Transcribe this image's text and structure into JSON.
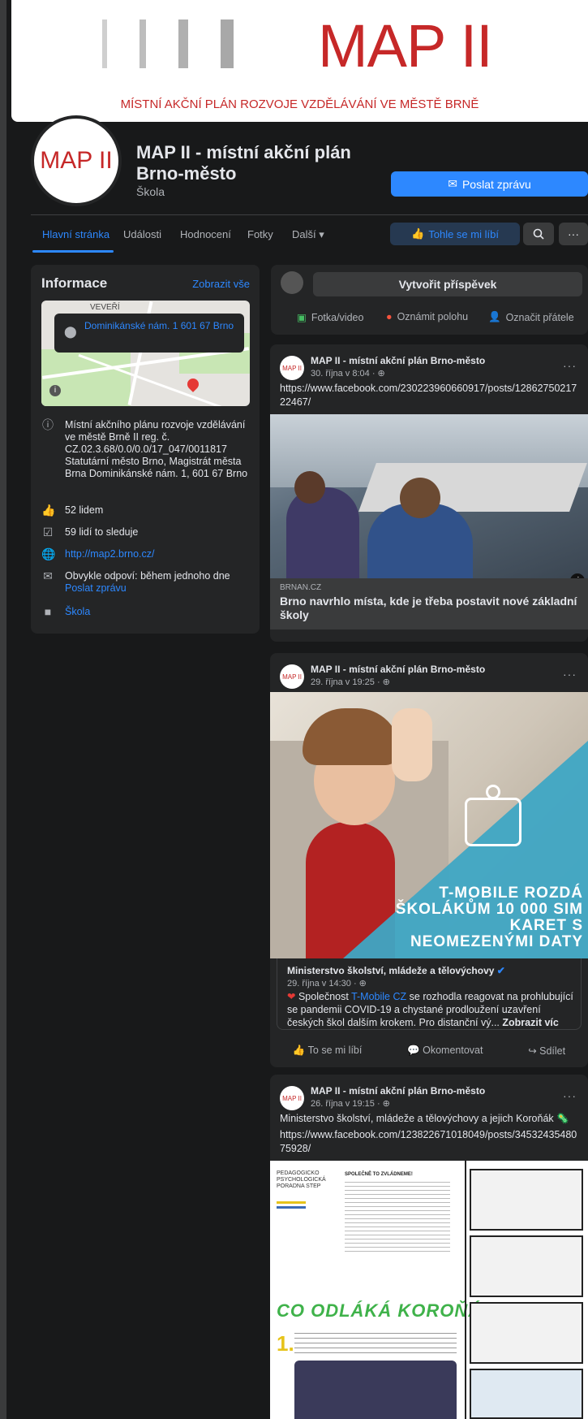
{
  "cover": {
    "title": "MAP II",
    "subtitle": "MÍSTNÍ AKČNÍ PLÁN ROZVOJE VZDĚLÁVÁNÍ VE MĚSTĚ BRNĚ"
  },
  "page": {
    "avatar_text": "MAP II",
    "name": "MAP II - místní akční plán Brno-město",
    "category": "Škola",
    "message_button": "Poslat zprávu"
  },
  "nav": {
    "tabs": [
      "Hlavní stránka",
      "Události",
      "Hodnocení",
      "Fotky",
      "Další ▾"
    ],
    "like_button": "Tohle se mi líbí",
    "search_icon": "search-icon",
    "more_icon": "more-icon"
  },
  "info": {
    "title": "Informace",
    "see_all": "Zobrazit vše",
    "map_label": "VEVEŘÍ",
    "map_address": "Dominikánské nám. 1 601 67 Brno",
    "description": "Místní akčního plánu rozvoje vzdělávání ve městě Brně II reg. č. CZ.02.3.68/0.0/0.0/17_047/0011817 Statutární město Brno, Magistrát města Brna Dominikánské nám. 1, 601 67 Brno",
    "likes": "52 lidem",
    "followers": "59 lidí to sleduje",
    "website": "http://map2.brno.cz/",
    "response": "Obvykle odpoví: během jednoho dne",
    "response_link": "Poslat zprávu",
    "category": "Škola"
  },
  "composer": {
    "create": "Vytvořit příspěvek",
    "photo": "Fotka/video",
    "location": "Oznámit polohu",
    "tag": "Označit přátele"
  },
  "posts": [
    {
      "author": "MAP II - místní akční plán Brno-město",
      "avatar": "MAP II",
      "date": "30. října v 8:04 · ⊕",
      "text": "https://www.facebook.com/230223960660917/posts/1286275021722467/",
      "link_source": "BRNAN.CZ",
      "link_title": "Brno navrhlo místa, kde je třeba postavit nové základní školy"
    },
    {
      "author": "MAP II - místní akční plán Brno-město",
      "avatar": "MAP II",
      "date": "29. října v 19:25 · ⊕",
      "image_text": "T-MOBILE ROZDÁ ŠKOLÁKŮM 10 000 SIM KARET S NEOMEZENÝMI DATY",
      "shared_author": "Ministerstvo školství, mládeže a tělovýchovy",
      "shared_date": "29. října v 14:30 · ⊕",
      "shared_text_pre": "Společnost",
      "shared_text_link": "T-Mobile CZ",
      "shared_text_post": "se rozhodla reagovat na prohlubující se pandemii COVID-19 a chystané prodloužení uzavření českých škol dalším krokem. Pro distanční vý...",
      "shared_more": "Zobrazit víc",
      "like": "To se mi líbí",
      "comment": "Okomentovat",
      "share": "Sdílet"
    },
    {
      "author": "MAP II - místní akční plán Brno-město",
      "avatar": "MAP II",
      "date": "26. října v 19:15 · ⊕",
      "text1": "Ministerstvo školství, mládeže a tělovýchovy a jejich Koroňák 🦠",
      "text2": "https://www.facebook.com/123822671018049/posts/3453243548075928/",
      "doc_header": "PEDAGOGICKO PSYCHOLOGICKÁ PORADNA STEP",
      "doc_title": "SPOLEČNĚ TO ZVLÁDNEME!",
      "comic_title": "CO ODLÁKÁ KOROŇÁKA?"
    }
  ],
  "colors": {
    "accent": "#2d88ff",
    "brand_red": "#c62828",
    "bg": "#18191a",
    "card": "#242526",
    "teal": "#3fa7c4"
  }
}
